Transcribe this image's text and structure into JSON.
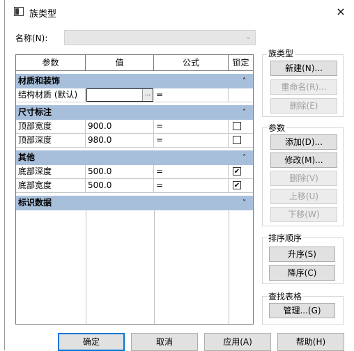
{
  "window": {
    "title": "族类型",
    "close_glyph": "×"
  },
  "name_field": {
    "label": "名称(N):",
    "value": ""
  },
  "grid": {
    "headers": [
      "参数",
      "值",
      "公式",
      "锁定"
    ],
    "groups": [
      {
        "name": "材质和装饰",
        "chevron": "˄",
        "rows": [
          {
            "param": "结构材质 (默认)",
            "value": "",
            "formula": "=",
            "locked": null,
            "editing": true
          }
        ]
      },
      {
        "name": "尺寸标注",
        "chevron": "˄",
        "rows": [
          {
            "param": "顶部宽度",
            "value": "900.0",
            "formula": "=",
            "locked": false
          },
          {
            "param": "顶部深度",
            "value": "980.0",
            "formula": "=",
            "locked": false
          }
        ]
      },
      {
        "name": "其他",
        "chevron": "˄",
        "rows": [
          {
            "param": "底部深度",
            "value": "500.0",
            "formula": "=",
            "locked": true
          },
          {
            "param": "底部宽度",
            "value": "500.0",
            "formula": "=",
            "locked": true
          }
        ]
      },
      {
        "name": "标识数据",
        "chevron": "˅",
        "rows": []
      }
    ],
    "browse_glyph": "..."
  },
  "family_types": {
    "title": "族类型",
    "buttons": [
      {
        "label": "新建(N)...",
        "enabled": true
      },
      {
        "label": "重命名(R)...",
        "enabled": false
      },
      {
        "label": "删除(E)",
        "enabled": false
      }
    ]
  },
  "parameters": {
    "title": "参数",
    "buttons": [
      {
        "label": "添加(D)...",
        "enabled": true
      },
      {
        "label": "修改(M)...",
        "enabled": true
      },
      {
        "label": "删除(V)",
        "enabled": false
      },
      {
        "label": "上移(U)",
        "enabled": false
      },
      {
        "label": "下移(W)",
        "enabled": false
      }
    ]
  },
  "sort_order": {
    "title": "排序顺序",
    "buttons": [
      {
        "label": "升序(S)",
        "enabled": true
      },
      {
        "label": "降序(C)",
        "enabled": true
      }
    ]
  },
  "lookup_tables": {
    "title": "查找表格",
    "buttons": [
      {
        "label": "管理...(G)",
        "enabled": true
      }
    ]
  },
  "footer": {
    "ok": "确定",
    "cancel": "取消",
    "apply": "应用(A)",
    "help": "帮助(H)"
  },
  "colors": {
    "group_header": "#a8bfdb",
    "default_button_border": "#0078d7"
  }
}
